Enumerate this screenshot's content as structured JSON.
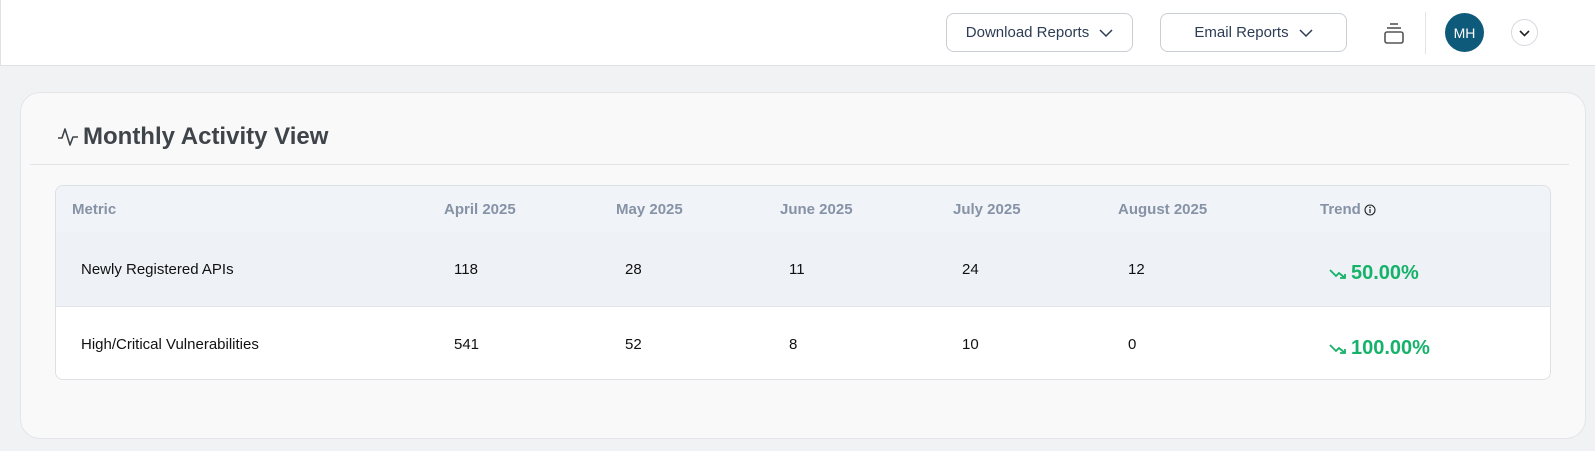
{
  "header": {
    "download_label": "Download Reports",
    "email_label": "Email Reports",
    "avatar_initials": "MH"
  },
  "card": {
    "title": "Monthly Activity View"
  },
  "table": {
    "headers": [
      "Metric",
      "April 2025",
      "May 2025",
      "June 2025",
      "July 2025",
      "August 2025",
      "Trend"
    ],
    "rows": [
      {
        "metric": "Newly Registered APIs",
        "values": [
          "118",
          "28",
          "11",
          "24",
          "12"
        ],
        "trend": "50.00%",
        "trend_direction": "down"
      },
      {
        "metric": "High/Critical Vulnerabilities",
        "values": [
          "541",
          "52",
          "8",
          "10",
          "0"
        ],
        "trend": "100.00%",
        "trend_direction": "down"
      }
    ]
  },
  "colors": {
    "avatar": "#0e5a7a",
    "trend": "#17b26a",
    "header_text": "#8692a6"
  }
}
